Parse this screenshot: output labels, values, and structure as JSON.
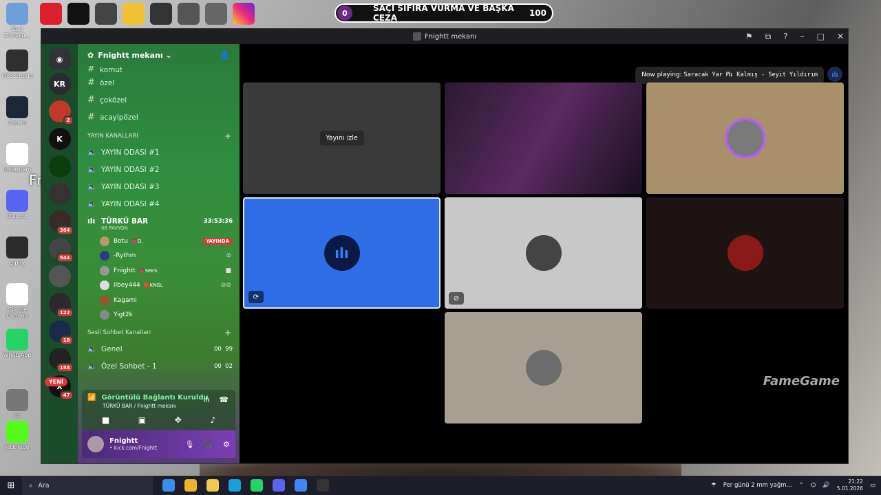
{
  "overlay": {
    "banner_score_left": "0",
    "banner_text": "SAÇI SIFIRA VURMA VE BAŞKA CEZA",
    "banner_score_right": "100",
    "streamer_name": "Fnightt"
  },
  "desktop_icons": [
    {
      "label": "Geri Dönüşü...",
      "icon": "recycle-bin-icon",
      "color": "#6ea0d8"
    },
    {
      "label": "OBS Studio",
      "icon": "obs-icon",
      "color": "#302e31"
    },
    {
      "label": "Steam",
      "icon": "steam-icon",
      "color": "#1b2838"
    },
    {
      "label": "Instagram",
      "icon": "chrome-icon",
      "color": "#ffffff"
    },
    {
      "label": "Discord",
      "icon": "discord-icon",
      "color": "#5865f2"
    },
    {
      "label": "giphy",
      "icon": "giphy-icon",
      "color": "#2b2b2b"
    },
    {
      "label": "Google Chrome",
      "icon": "chrome-icon",
      "color": "#ffffff"
    },
    {
      "label": "WhatsApp",
      "icon": "whatsapp-icon",
      "color": "#25d366"
    },
    {
      "label": "cz",
      "icon": "blank-icon",
      "color": "#777777"
    },
    {
      "label": "kick logo",
      "icon": "kick-icon",
      "color": "#53fc18"
    }
  ],
  "window": {
    "title": "Fnightt mekanı"
  },
  "rail": {
    "servers": [
      {
        "label": "KR",
        "badge": ""
      },
      {
        "label": "",
        "badge": "2"
      },
      {
        "label": "K",
        "badge": ""
      },
      {
        "label": "",
        "badge": ""
      },
      {
        "label": "",
        "badge": ""
      },
      {
        "label": "",
        "badge": "384"
      },
      {
        "label": "",
        "badge": "544"
      },
      {
        "label": "",
        "badge": ""
      },
      {
        "label": "",
        "badge": "122"
      },
      {
        "label": "",
        "badge": "18"
      },
      {
        "label": "",
        "badge": "158"
      },
      {
        "label": "X",
        "badge": "47"
      }
    ],
    "new_label": "YENİ"
  },
  "sidebar": {
    "server_name": "Fnightt mekanı",
    "text_channels": [
      "komut",
      "özel",
      "çoközel",
      "acayipözel"
    ],
    "stream_category": "YAYIN KANALLARI",
    "stream_channels": [
      "YAYIN ODASI #1",
      "YAYIN ODASI #2",
      "YAYIN ODASI #3",
      "YAYIN ODASI #4"
    ],
    "active_channel": {
      "name": "TÜRKÜ BAR",
      "timer": "33:53:36",
      "status": "06 PAVYON"
    },
    "members": [
      {
        "name": "Botu",
        "tag": "💗Q.",
        "live": "YAYINDA",
        "color": "#b89a70"
      },
      {
        "name": "-Rythm",
        "tag": "",
        "live": "",
        "color": "#2a3a80"
      },
      {
        "name": "Fnightt",
        "tag": "💗SEKS",
        "live": "",
        "color": "#999999"
      },
      {
        "name": "ilbey444",
        "tag": "🔴KNGL",
        "live": "",
        "color": "#dddddd"
      },
      {
        "name": "Kagami",
        "tag": "",
        "live": "",
        "color": "#a0522d"
      },
      {
        "name": "Yigt2k",
        "tag": "",
        "live": "",
        "color": "#888888"
      }
    ],
    "voice_category": "Sesli Sohbet Kanalları",
    "voice_channels": [
      {
        "name": "Genel",
        "count": "00",
        "limit": "99"
      },
      {
        "name": "Özel Sohbet - 1",
        "count": "00",
        "limit": "02"
      }
    ]
  },
  "voice_panel": {
    "status": "Görüntülü Bağlantı Kuruldu",
    "location": "TÜRKÜ BAR / Fnightt mekanı"
  },
  "user_panel": {
    "name": "Fnightt",
    "status": "• kick.com/Fnightt"
  },
  "stage": {
    "watch_label": "Yayını izle",
    "now_playing_label": "Now playing:",
    "now_playing_value": "Saracak Yar Mı Kalmış - Seyit Yıldırım",
    "watermark": "FameGame"
  },
  "taskbar": {
    "search_label": "Ara",
    "weather": "Per günü 2 mm yağm...",
    "time": "21:22",
    "date": "5.01.2026"
  }
}
